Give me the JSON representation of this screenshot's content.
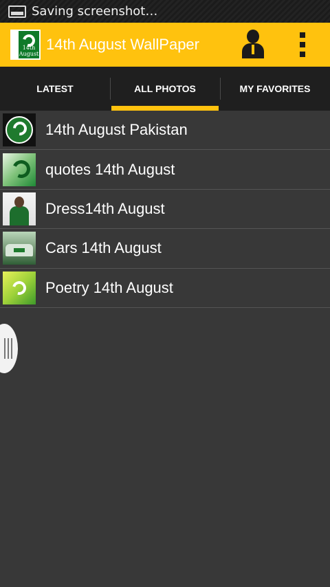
{
  "status_bar": {
    "notification_text": "Saving screenshot…",
    "icon": "screenshot-icon"
  },
  "action_bar": {
    "title": "14th August WallPaper",
    "logo_text": "14th August",
    "background_color": "#ffc20e",
    "profile_icon": "person-icon",
    "menu_icon": "overflow-menu-icon"
  },
  "tabs": [
    {
      "label": "LATEST",
      "active": false
    },
    {
      "label": "ALL PHOTOS",
      "active": true
    },
    {
      "label": "MY FAVORITES",
      "active": false
    }
  ],
  "categories": [
    {
      "label": "14th August Pakistan",
      "thumbnail": "pakistan-flag-thumbnail"
    },
    {
      "label": "quotes 14th August",
      "thumbnail": "quotes-thumbnail"
    },
    {
      "label": "Dress14th August",
      "thumbnail": "dress-thumbnail"
    },
    {
      "label": "Cars 14th August",
      "thumbnail": "cars-thumbnail"
    },
    {
      "label": "Poetry 14th August",
      "thumbnail": "poetry-thumbnail"
    }
  ],
  "side_handle_icon": "drawer-handle-icon"
}
